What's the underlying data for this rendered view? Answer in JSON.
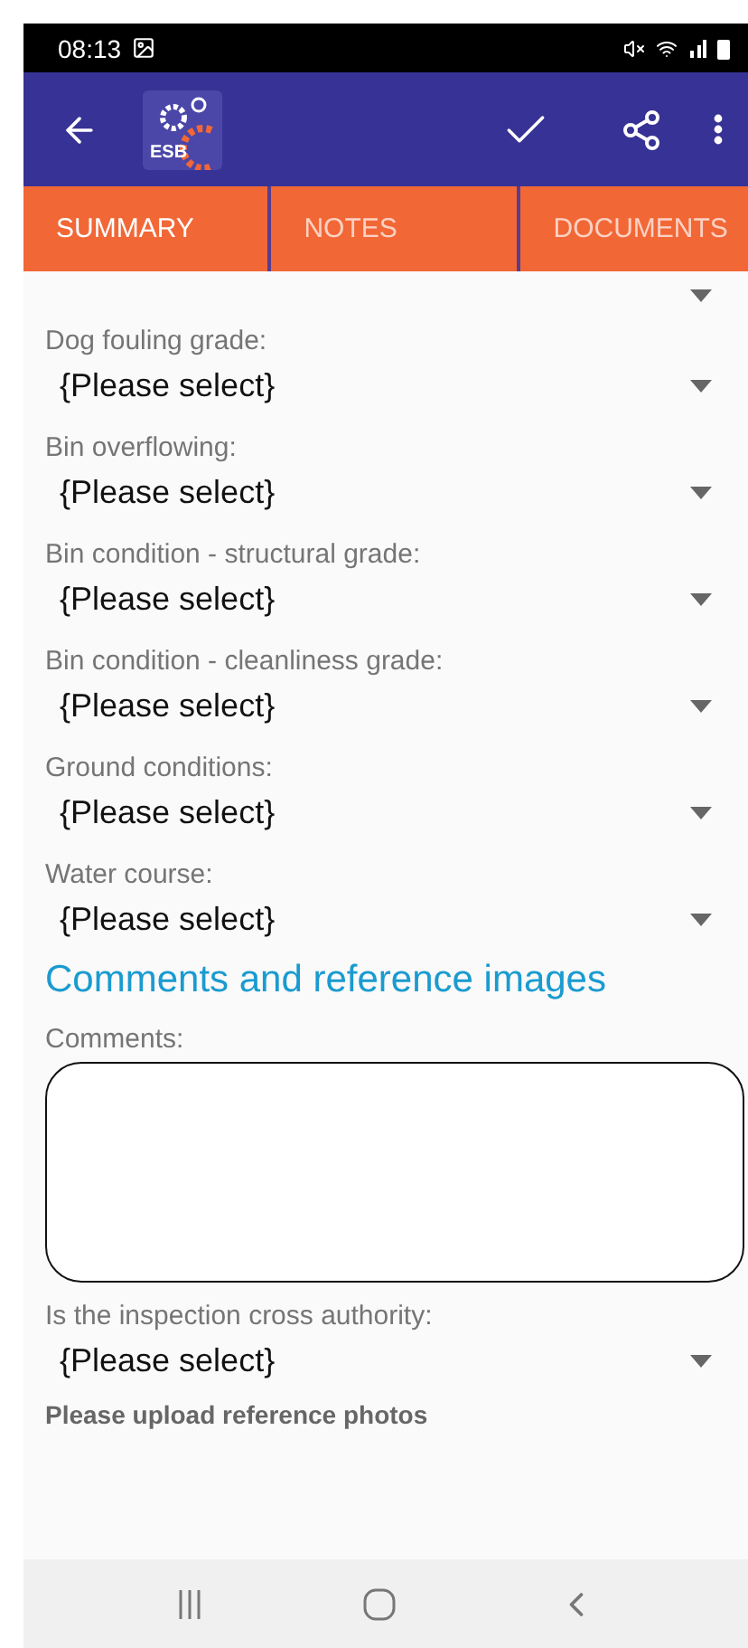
{
  "status_bar": {
    "time": "08:13"
  },
  "app_bar": {
    "logo_text": "ESB"
  },
  "tabs": [
    {
      "label": "SUMMARY",
      "selected": true
    },
    {
      "label": "NOTES",
      "selected": false
    },
    {
      "label": "DOCUMENTS",
      "selected": false
    }
  ],
  "fields": [
    {
      "kind": "select-cut"
    },
    {
      "kind": "select",
      "label": "Dog fouling grade:",
      "value": "{Please select}"
    },
    {
      "kind": "select",
      "label": "Bin overflowing:",
      "value": "{Please select}"
    },
    {
      "kind": "select",
      "label": "Bin condition - structural grade:",
      "value": "{Please select}"
    },
    {
      "kind": "select",
      "label": "Bin condition - cleanliness grade:",
      "value": "{Please select}"
    },
    {
      "kind": "select",
      "label": "Ground conditions:",
      "value": "{Please select}"
    },
    {
      "kind": "select",
      "label": "Water course:",
      "value": "{Please select}"
    },
    {
      "kind": "heading",
      "label": "Comments and reference images"
    },
    {
      "kind": "textarea",
      "label": "Comments:"
    },
    {
      "kind": "select",
      "label": "Is the inspection cross authority:",
      "value": "{Please select}"
    },
    {
      "kind": "note",
      "label": "Please upload reference photos"
    }
  ]
}
